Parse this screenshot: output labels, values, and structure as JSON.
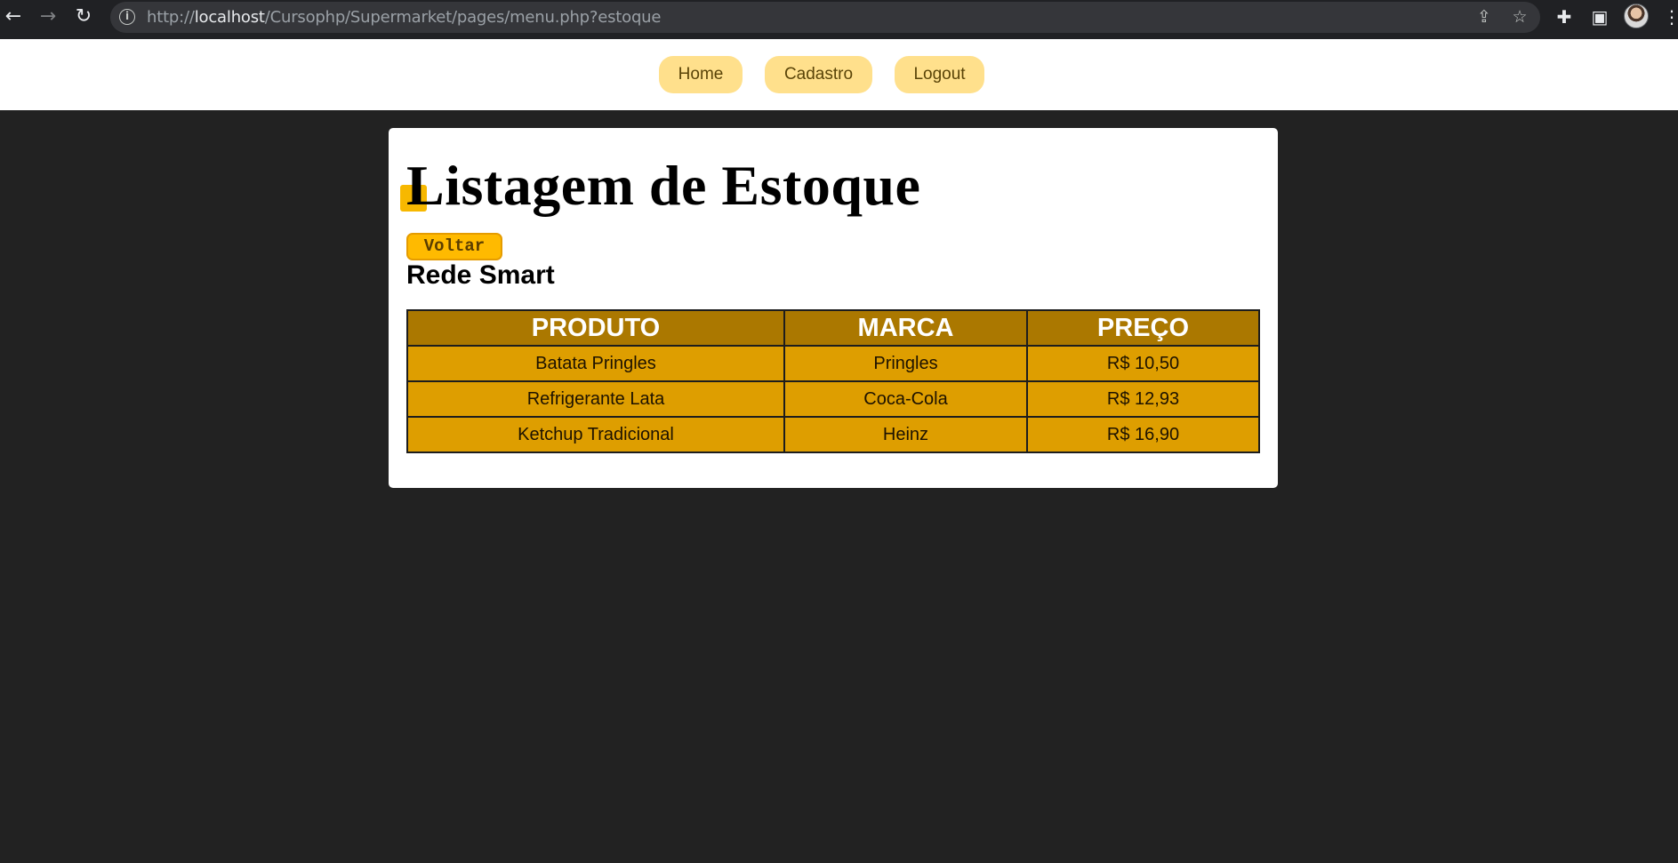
{
  "browser": {
    "url_scheme": "http://",
    "url_host": "localhost",
    "url_path": "/Cursophp/Supermarket/pages/menu.php?estoque",
    "icons": [
      "back-arrow-icon",
      "forward-arrow-icon",
      "reload-icon",
      "info-icon",
      "share-icon",
      "star-icon",
      "extensions-icon",
      "side-panel-icon",
      "profile-avatar",
      "more-menu-icon"
    ]
  },
  "header": {
    "nav": [
      {
        "label": "Home"
      },
      {
        "label": "Cadastro"
      },
      {
        "label": "Logout"
      }
    ]
  },
  "main": {
    "title": "Listagem de Estoque",
    "back_label": "Voltar",
    "store_name": "Rede Smart",
    "table": {
      "headers": [
        "PRODUTO",
        "MARCA",
        "PREÇO"
      ],
      "rows": [
        [
          "Batata Pringles",
          "Pringles",
          "R$ 10,50"
        ],
        [
          "Refrigerante Lata",
          "Coca-Cola",
          "R$ 12,93"
        ],
        [
          "Ketchup Tradicional",
          "Heinz",
          "R$ 16,90"
        ]
      ]
    }
  },
  "colors": {
    "page_bg": "#222222",
    "nav_button": "#ffe08c",
    "table_header": "#ab7800",
    "table_cell": "#de9e00",
    "back_button": "#ffba00"
  }
}
